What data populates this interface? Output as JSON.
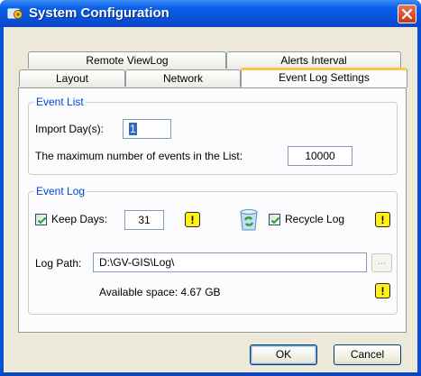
{
  "window": {
    "title": "System Configuration",
    "icon": "gear-system-icon",
    "close_icon": "close-icon"
  },
  "tabs": {
    "row_back": [
      {
        "label": "Remote ViewLog"
      },
      {
        "label": "Alerts Interval"
      }
    ],
    "row_front": [
      {
        "label": "Layout"
      },
      {
        "label": "Network"
      },
      {
        "label": "Event Log Settings",
        "active": true
      }
    ]
  },
  "event_list": {
    "legend": "Event List",
    "import_days_label": "Import Day(s):",
    "import_days_value": "1",
    "max_events_label": "The maximum number of events in the List:",
    "max_events_value": "10000"
  },
  "event_log": {
    "legend": "Event Log",
    "keep_days_label": "Keep Days:",
    "keep_days_checked": true,
    "keep_days_value": "31",
    "recycle_label": "Recycle Log",
    "recycle_checked": true,
    "recycle_icon": "recycle-bin-icon",
    "warning_icon": "warning-icon",
    "warning_glyph": "!",
    "log_path_label": "Log Path:",
    "log_path_value": "D:\\GV-GIS\\Log\\",
    "browse_label": "...",
    "available_space": "Available space: 4.67 GB"
  },
  "buttons": {
    "ok": "OK",
    "cancel": "Cancel"
  },
  "colors": {
    "title_bar": "#0a5fe8",
    "active_tab_accent": "#ffc83c",
    "group_legend": "#0046d5",
    "warning": "#ffef1a"
  }
}
